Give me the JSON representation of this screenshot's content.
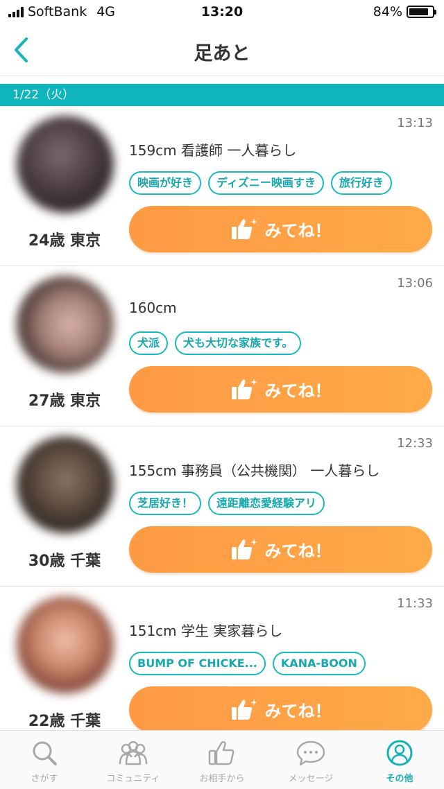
{
  "status_bar": {
    "carrier": "SoftBank",
    "network": "4G",
    "time": "13:20",
    "battery": "84%",
    "battery_level": 0.84
  },
  "nav": {
    "title": "足あと"
  },
  "date_header": "1/22（火）",
  "cards": [
    {
      "time": "13:13",
      "profile": "159cm 看護師 一人暮らし",
      "tags": [
        "映画が好き",
        "ディズニー映画すき",
        "旅行好き"
      ],
      "age_location": "24歳 東京",
      "like_label": "みてね！"
    },
    {
      "time": "13:06",
      "profile": "160cm",
      "tags": [
        "犬派",
        "犬も大切な家族です。"
      ],
      "age_location": "27歳 東京",
      "like_label": "みてね！"
    },
    {
      "time": "12:33",
      "profile": "155cm 事務員（公共機関） 一人暮らし",
      "tags": [
        "芝居好き！",
        "遠距離恋愛経験アリ"
      ],
      "age_location": "30歳 千葉",
      "like_label": "みてね！"
    },
    {
      "time": "11:33",
      "profile": "151cm 学生 実家暮らし",
      "tags": [
        "BUMP OF CHICKE...",
        "KANA-BOON"
      ],
      "age_location": "22歳 千葉",
      "like_label": "みてね！"
    }
  ],
  "tabs": [
    {
      "label": "さがす",
      "icon": "search-icon",
      "active": false
    },
    {
      "label": "コミュニティ",
      "icon": "community-icon",
      "active": false
    },
    {
      "label": "お相手から",
      "icon": "thumbs-up-icon",
      "active": false
    },
    {
      "label": "メッセージ",
      "icon": "message-icon",
      "active": false
    },
    {
      "label": "その他",
      "icon": "profile-icon",
      "active": true
    }
  ],
  "colors": {
    "accent": "#0fb5bc",
    "like_button": "#ff9e45",
    "tab_inactive": "#a8a8a8"
  }
}
